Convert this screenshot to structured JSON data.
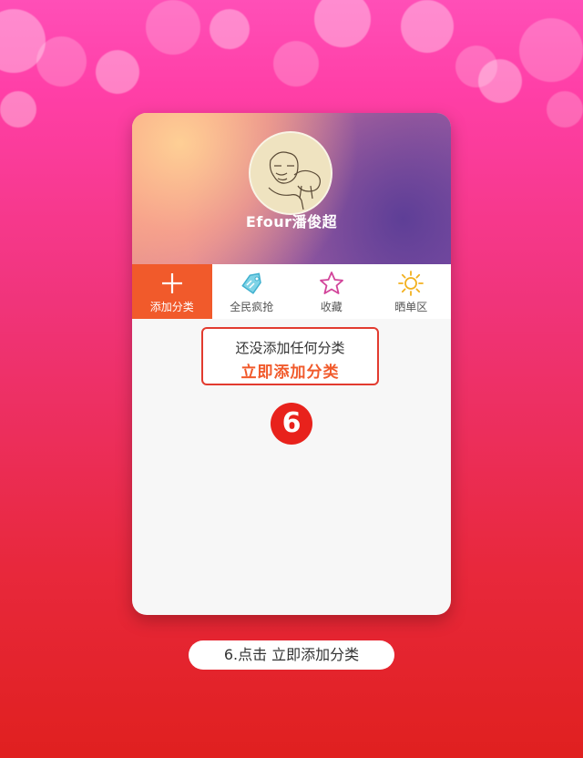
{
  "profile": {
    "username": "Efour潘俊超",
    "avatar_icon": "avatar-sketch-icon"
  },
  "tabs": [
    {
      "label": "添加分类",
      "icon": "plus-icon",
      "active": true
    },
    {
      "label": "全民疯抢",
      "icon": "tag-icon",
      "active": false
    },
    {
      "label": "收藏",
      "icon": "star-icon",
      "active": false
    },
    {
      "label": "晒单区",
      "icon": "sun-icon",
      "active": false
    }
  ],
  "empty_state": {
    "message": "还没添加任何分类",
    "action_label": "立即添加分类"
  },
  "step_badge": "6",
  "caption": "6.点击 立即添加分类",
  "colors": {
    "accent": "#f15a2b",
    "highlight": "#e23b2f",
    "badge": "#e8221c"
  }
}
